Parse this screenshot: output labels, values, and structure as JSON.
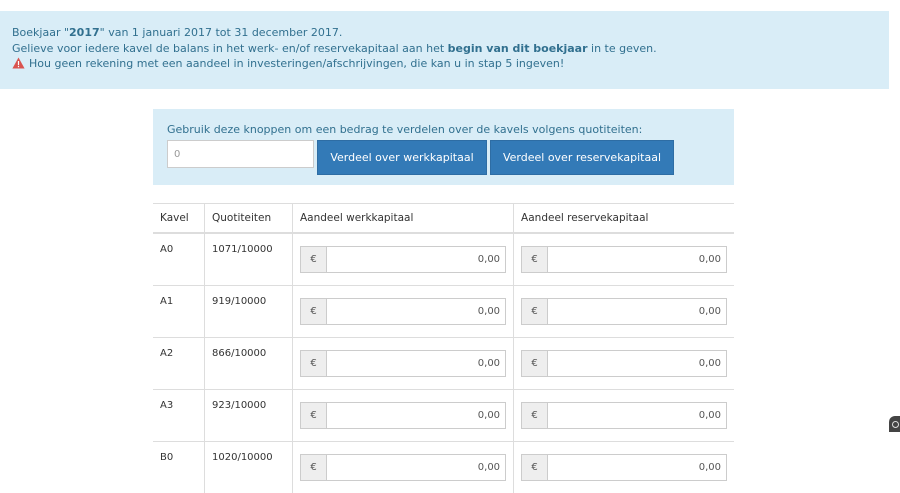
{
  "info": {
    "line1_prefix": "Boekjaar \"",
    "line1_year": "2017",
    "line1_suffix": "\" van 1 januari 2017 tot 31 december 2017.",
    "line2_prefix": "Gelieve voor iedere kavel de balans in het werk- en/of reservekapitaal aan het ",
    "line2_bold": "begin van dit boekjaar",
    "line2_suffix": " in te geven.",
    "line3": "Hou geen rekening met een aandeel in investeringen/afschrijvingen, die kan u in stap 5 ingeven!"
  },
  "distribute": {
    "label": "Gebruik deze knoppen om een bedrag te verdelen over de kavels volgens quotiteiten:",
    "input_value": "0",
    "btn_werk": "Verdeel over werkkapitaal",
    "btn_reserve": "Verdeel over reservekapitaal"
  },
  "table": {
    "headers": [
      "Kavel",
      "Quotiteiten",
      "Aandeel werkkapitaal",
      "Aandeel reservekapitaal"
    ],
    "currency": "€",
    "rows": [
      {
        "kavel": "A0",
        "quot": "1071/10000",
        "werk": "0,00",
        "reserve": "0,00"
      },
      {
        "kavel": "A1",
        "quot": "919/10000",
        "werk": "0,00",
        "reserve": "0,00"
      },
      {
        "kavel": "A2",
        "quot": "866/10000",
        "werk": "0,00",
        "reserve": "0,00"
      },
      {
        "kavel": "A3",
        "quot": "923/10000",
        "werk": "0,00",
        "reserve": "0,00"
      },
      {
        "kavel": "B0",
        "quot": "1020/10000",
        "werk": "0,00",
        "reserve": "0,00"
      }
    ]
  },
  "colors": {
    "info_bg": "#d9edf7",
    "info_text": "#31708f",
    "button_bg": "#337ab7",
    "warning_red": "#d9534f"
  },
  "icons": {
    "warning": "warning-triangle-icon",
    "corner": "settings-badge-icon"
  }
}
